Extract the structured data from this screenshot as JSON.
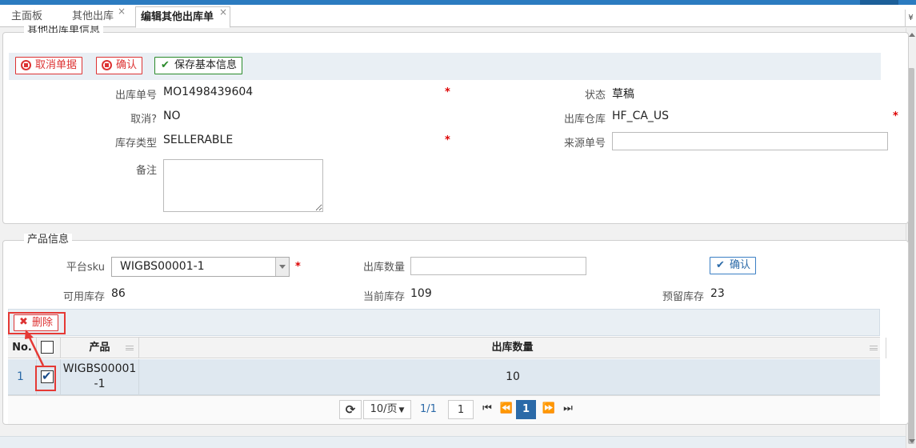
{
  "tabs": [
    {
      "label": "主面板",
      "closable": false
    },
    {
      "label": "其他出库",
      "closable": true
    },
    {
      "label": "编辑其他出库单",
      "closable": true,
      "active": true
    }
  ],
  "tab_close_glyph": "×",
  "tab_scroll_glyph": "¥",
  "header_panel": {
    "legend": "其他出库单信息",
    "buttons": {
      "cancel": "取消单据",
      "confirm": "确认",
      "save": "保存基本信息"
    },
    "fields": {
      "order_no_label": "出库单号",
      "order_no_value": "MO1498439604",
      "status_label": "状态",
      "status_value": "草稿",
      "cancelled_label": "取消?",
      "cancelled_value": "NO",
      "warehouse_label": "出库仓库",
      "warehouse_value": "HF_CA_US",
      "stock_type_label": "库存类型",
      "stock_type_value": "SELLERABLE",
      "source_no_label": "来源单号",
      "source_no_value": "",
      "remark_label": "备注",
      "remark_value": ""
    },
    "required_mark": "*"
  },
  "product_panel": {
    "legend": "产品信息",
    "sku_label": "平台sku",
    "sku_value": "WIGBS00001-1",
    "qty_label": "出库数量",
    "qty_value": "",
    "confirm_label": "确认",
    "available_label": "可用库存",
    "available_value": "86",
    "current_label": "当前库存",
    "current_value": "109",
    "reserved_label": "预留库存",
    "reserved_value": "23"
  },
  "grid": {
    "delete_label": "删除",
    "headers": {
      "no": "No.",
      "product": "产品",
      "qty": "出库数量"
    },
    "rows": [
      {
        "no": "1",
        "product_line1": "WIGBS00001",
        "product_line2": "-1",
        "qty": "10",
        "checked": true
      }
    ],
    "pager": {
      "page_size": "10/页",
      "page_info": "1/1",
      "page_input": "1",
      "current_page": "1"
    }
  },
  "colors": {
    "accent": "#2b7bc0",
    "danger": "#dd3333",
    "success": "#2a8a2a",
    "annotation": "#e53935"
  }
}
